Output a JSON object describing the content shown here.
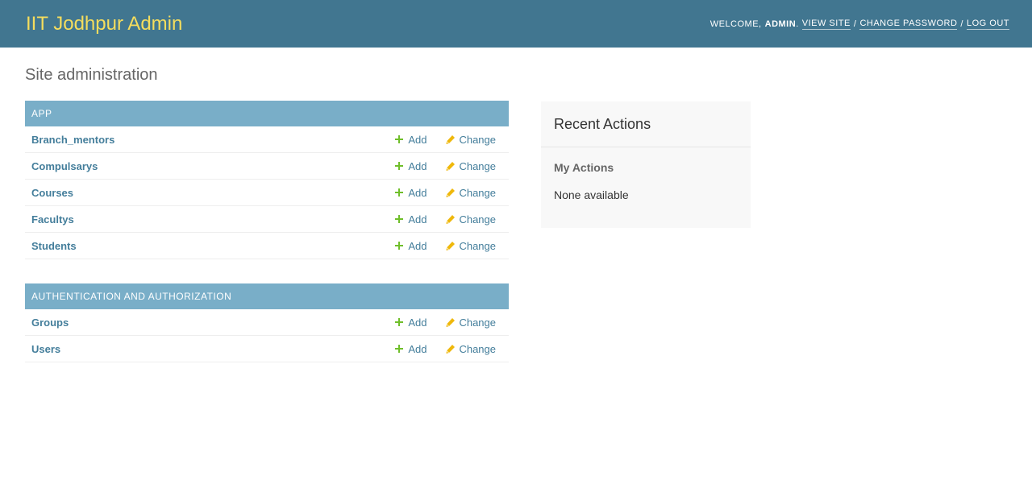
{
  "header": {
    "site_name": "IIT Jodhpur Admin",
    "welcome": "Welcome,",
    "username": "admin",
    "view_site": "View site",
    "change_password": "Change password",
    "log_out": "Log out",
    "separator": "/"
  },
  "page_title": "Site administration",
  "modules": [
    {
      "caption": "App",
      "models": [
        {
          "name": "Branch_mentors",
          "add": "Add",
          "change": "Change"
        },
        {
          "name": "Compulsarys",
          "add": "Add",
          "change": "Change"
        },
        {
          "name": "Courses",
          "add": "Add",
          "change": "Change"
        },
        {
          "name": "Facultys",
          "add": "Add",
          "change": "Change"
        },
        {
          "name": "Students",
          "add": "Add",
          "change": "Change"
        }
      ]
    },
    {
      "caption": "Authentication and Authorization",
      "models": [
        {
          "name": "Groups",
          "add": "Add",
          "change": "Change"
        },
        {
          "name": "Users",
          "add": "Add",
          "change": "Change"
        }
      ]
    }
  ],
  "recent_actions": {
    "title": "Recent Actions",
    "subtitle": "My Actions",
    "empty": "None available"
  },
  "colors": {
    "header_bg": "#417690",
    "brand": "#f5dd5d",
    "caption_bg": "#79aec8",
    "link": "#447e9b",
    "add_icon": "#70bf2b",
    "change_icon": "#efb80b"
  },
  "icons": {
    "add": "plus-icon",
    "change": "pencil-icon"
  }
}
